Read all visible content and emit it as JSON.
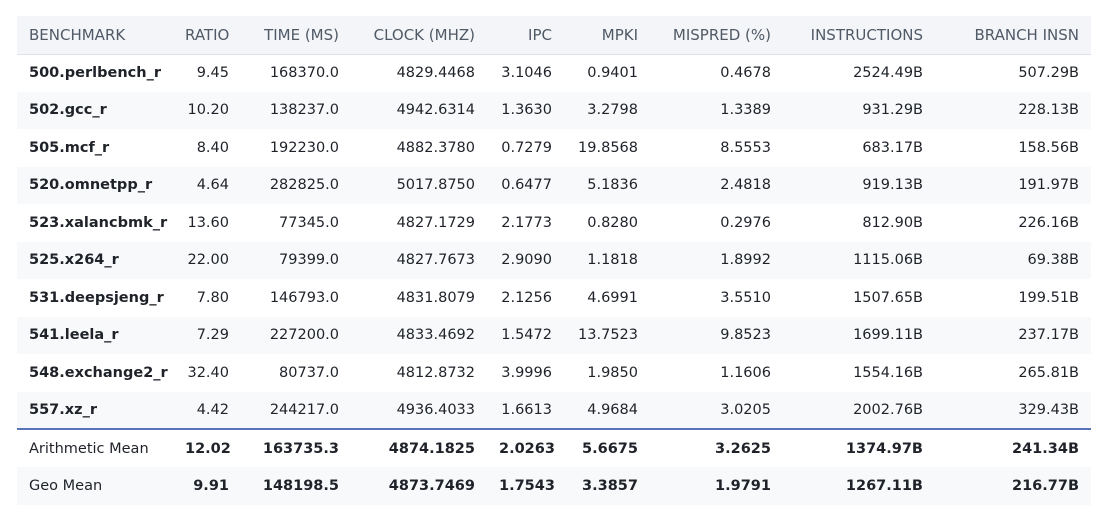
{
  "table": {
    "headers": [
      "BENCHMARK",
      "RATIO",
      "TIME (MS)",
      "CLOCK (MHZ)",
      "IPC",
      "MPKI",
      "MISPRED (%)",
      "INSTRUCTIONS",
      "BRANCH INSN"
    ],
    "rows": [
      [
        "500.perlbench_r",
        "9.45",
        "168370.0",
        "4829.4468",
        "3.1046",
        "0.9401",
        "0.4678",
        "2524.49B",
        "507.29B"
      ],
      [
        "502.gcc_r",
        "10.20",
        "138237.0",
        "4942.6314",
        "1.3630",
        "3.2798",
        "1.3389",
        "931.29B",
        "228.13B"
      ],
      [
        "505.mcf_r",
        "8.40",
        "192230.0",
        "4882.3780",
        "0.7279",
        "19.8568",
        "8.5553",
        "683.17B",
        "158.56B"
      ],
      [
        "520.omnetpp_r",
        "4.64",
        "282825.0",
        "5017.8750",
        "0.6477",
        "5.1836",
        "2.4818",
        "919.13B",
        "191.97B"
      ],
      [
        "523.xalancbmk_r",
        "13.60",
        "77345.0",
        "4827.1729",
        "2.1773",
        "0.8280",
        "0.2976",
        "812.90B",
        "226.16B"
      ],
      [
        "525.x264_r",
        "22.00",
        "79399.0",
        "4827.7673",
        "2.9090",
        "1.1818",
        "1.8992",
        "1115.06B",
        "69.38B"
      ],
      [
        "531.deepsjeng_r",
        "7.80",
        "146793.0",
        "4831.8079",
        "2.1256",
        "4.6991",
        "3.5510",
        "1507.65B",
        "199.51B"
      ],
      [
        "541.leela_r",
        "7.29",
        "227200.0",
        "4833.4692",
        "1.5472",
        "13.7523",
        "9.8523",
        "1699.11B",
        "237.17B"
      ],
      [
        "548.exchange2_r",
        "32.40",
        "80737.0",
        "4812.8732",
        "3.9996",
        "1.9850",
        "1.1606",
        "1554.16B",
        "265.81B"
      ],
      [
        "557.xz_r",
        "4.42",
        "244217.0",
        "4936.4033",
        "1.6613",
        "4.9684",
        "3.0205",
        "2002.76B",
        "329.43B"
      ]
    ],
    "summary": [
      [
        "Arithmetic Mean",
        "12.02",
        "163735.3",
        "4874.1825",
        "2.0263",
        "5.6675",
        "3.2625",
        "1374.97B",
        "241.34B"
      ],
      [
        "Geo Mean",
        "9.91",
        "148198.5",
        "4873.7469",
        "1.7543",
        "3.3857",
        "1.9791",
        "1267.11B",
        "216.77B"
      ]
    ]
  }
}
